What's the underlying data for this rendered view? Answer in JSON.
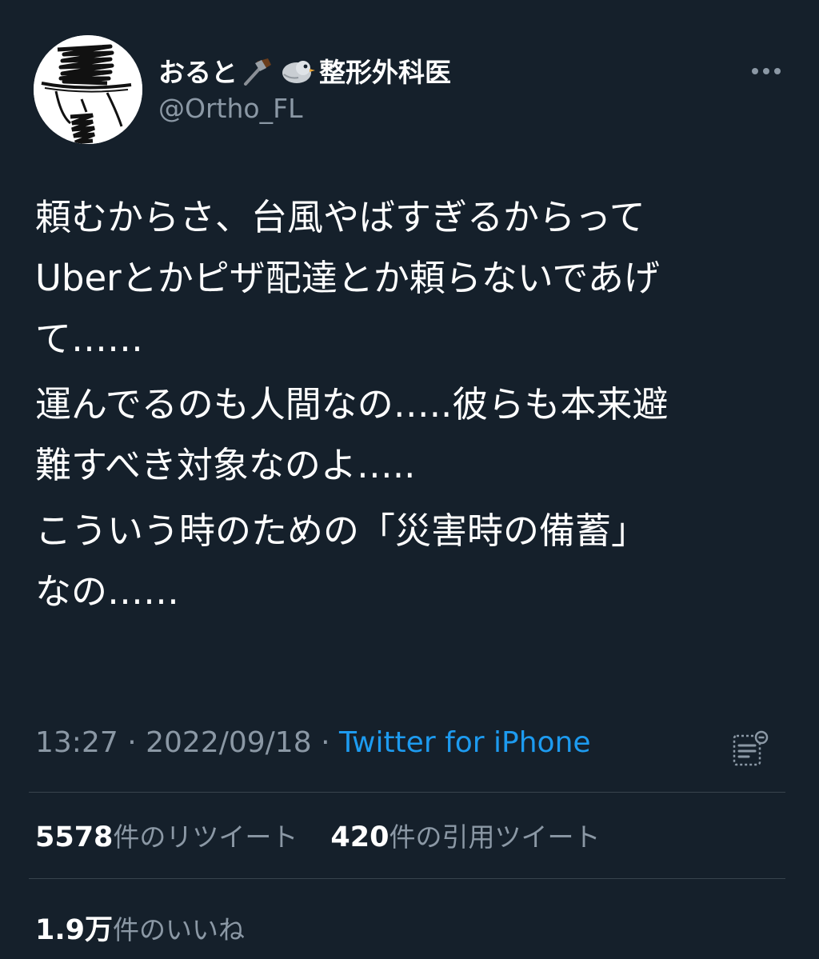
{
  "author": {
    "name_prefix": "おると",
    "name_suffix": "整形外科医",
    "hammer_emoji": "hammer-emoji",
    "bird_emoji": "bird-emoji",
    "handle": "@Ortho_FL"
  },
  "tweet": {
    "paragraphs": [
      "頼むからさ、台風やばすぎるからって\nUberとかピザ配達とか頼らないであげ\nて……",
      "運んでるのも人間なの…..彼らも本来避\n難すべき対象なのよ…..",
      "こういう時のための「災害時の備蓄」\nなの……"
    ],
    "time": "13:27",
    "date": "2022/09/18",
    "separator": "·",
    "source": "Twitter for iPhone"
  },
  "stats": {
    "retweets_count": "5578",
    "retweets_label": "件のリツイート",
    "quotes_count": "420",
    "quotes_label": "件の引用ツイート",
    "likes_count": "1.9万",
    "likes_label": "件のいいね"
  },
  "icons": {
    "more": "more-icon",
    "analytics": "analytics-icon"
  },
  "colors": {
    "background": "#15202b",
    "secondary_text": "#8b98a5",
    "link": "#1d9bf0",
    "divider": "#38444d"
  }
}
